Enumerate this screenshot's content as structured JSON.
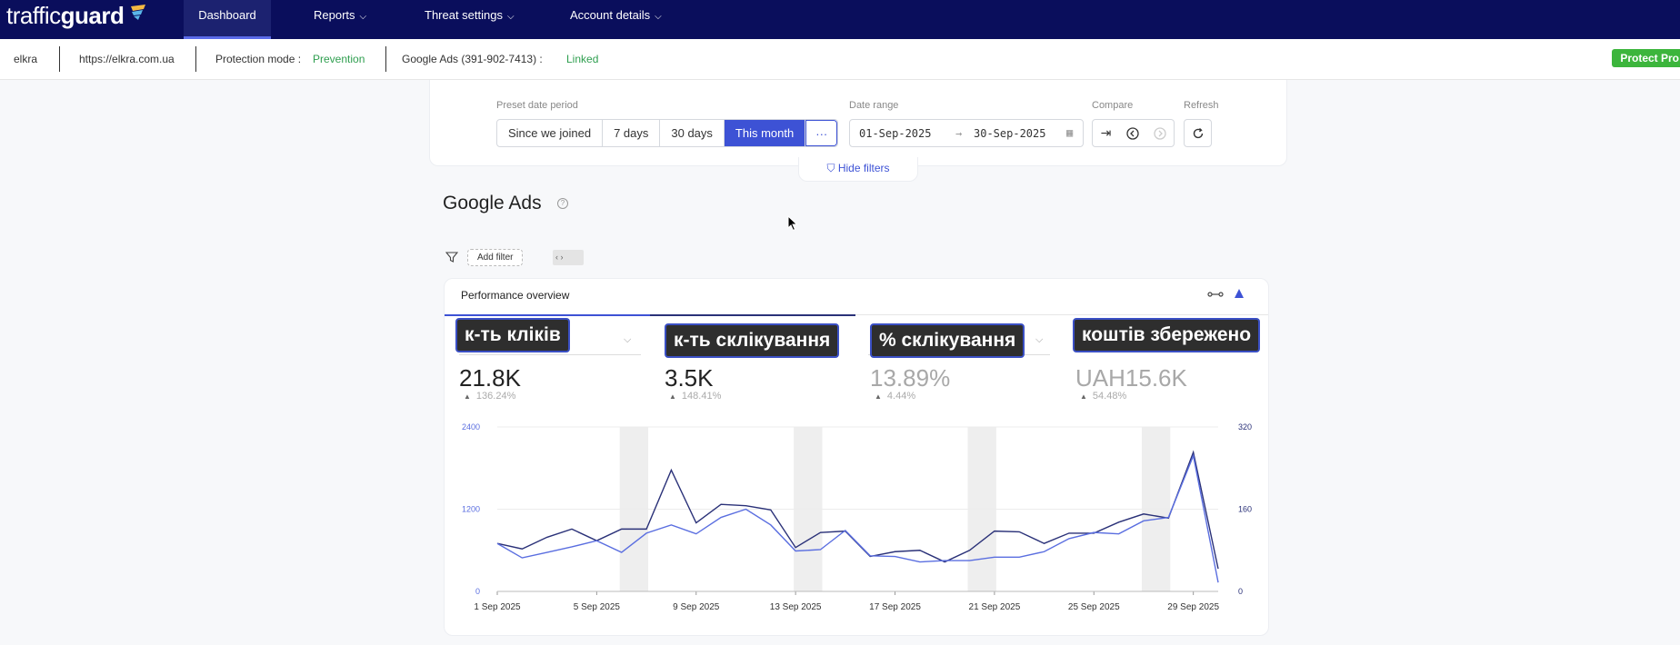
{
  "nav": {
    "logo_light": "traffic",
    "logo_bold": "guard",
    "items": [
      {
        "label": "Dashboard",
        "active": true
      },
      {
        "label": "Reports",
        "chevron": true
      },
      {
        "label": "Threat settings",
        "chevron": true
      },
      {
        "label": "Account details",
        "chevron": true
      }
    ]
  },
  "infobar": {
    "account": "elkra",
    "url": "https://elkra.com.ua",
    "protection_label": "Protection mode :",
    "protection_value": "Prevention",
    "google_ads_label": "Google Ads (391-902-7413) :",
    "google_ads_status": "Linked",
    "protect_button": "Protect Pro"
  },
  "filters": {
    "preset_label": "Preset date period",
    "presets": [
      "Since we joined",
      "7 days",
      "30 days",
      "This month",
      "···"
    ],
    "active_preset": "This month",
    "date_range_label": "Date range",
    "date_from": "01-Sep-2025",
    "date_to": "30-Sep-2025",
    "compare_label": "Compare",
    "refresh_label": "Refresh",
    "hide_filters": "Hide filters"
  },
  "section": {
    "title": "Google Ads",
    "add_filter": "Add filter"
  },
  "performance": {
    "title": "Performance overview",
    "metrics": [
      {
        "label": "к-ть кліків",
        "value": "21.8K",
        "change": "136.24%",
        "color": "#222222"
      },
      {
        "label": "к-ть склікування",
        "value": "3.5K",
        "change": "148.41%",
        "color": "#222222"
      },
      {
        "label": "% склікування",
        "value": "13.89%",
        "change": "4.44%",
        "color": "#a8a8a8"
      },
      {
        "label": "коштів збережено",
        "value": "UAH15.6K",
        "change": "54.48%",
        "color": "#a8a8a8"
      }
    ]
  },
  "colors": {
    "nav_bg": "#0a0e5c",
    "accent": "#3d52d5",
    "series_dark": "#2a3178",
    "series_light": "#5a6ee0",
    "green": "#2e9e4f"
  },
  "chart_data": {
    "type": "line",
    "x_ticks": [
      "1 Sep 2025",
      "5 Sep 2025",
      "9 Sep 2025",
      "13 Sep 2025",
      "17 Sep 2025",
      "21 Sep 2025",
      "25 Sep 2025",
      "29 Sep 2025"
    ],
    "y_left_ticks": [
      "0",
      "1200",
      "2400"
    ],
    "y_right_ticks": [
      "0",
      "160",
      "320"
    ],
    "y_left_range": [
      0,
      2400
    ],
    "y_right_range": [
      0,
      320
    ],
    "weekend_bands_start_day": [
      6,
      13,
      20,
      27
    ],
    "series": [
      {
        "axis": "left",
        "color": "#2a3178",
        "x": [
          1,
          2,
          3,
          4,
          5,
          6,
          7,
          8,
          9,
          10,
          11,
          12,
          13,
          14,
          15,
          16,
          17,
          18,
          19,
          20,
          21,
          22,
          23,
          24,
          25,
          26,
          27,
          28,
          29,
          30
        ],
        "values": [
          700,
          620,
          790,
          910,
          740,
          910,
          910,
          1770,
          1000,
          1270,
          1250,
          1190,
          640,
          860,
          880,
          510,
          580,
          600,
          430,
          600,
          880,
          870,
          700,
          850,
          850,
          1010,
          1130,
          1070,
          2030,
          330
        ]
      },
      {
        "axis": "left",
        "color": "#5a6ee0",
        "x": [
          1,
          2,
          3,
          4,
          5,
          6,
          7,
          8,
          9,
          10,
          11,
          12,
          13,
          14,
          15,
          16,
          17,
          18,
          19,
          20,
          21,
          22,
          23,
          24,
          25,
          26,
          27,
          28,
          29,
          30
        ],
        "values": [
          700,
          490,
          570,
          650,
          740,
          570,
          850,
          970,
          840,
          1080,
          1200,
          970,
          590,
          610,
          890,
          520,
          510,
          430,
          450,
          450,
          500,
          500,
          580,
          770,
          860,
          840,
          1030,
          1080,
          1980,
          130
        ]
      }
    ]
  }
}
